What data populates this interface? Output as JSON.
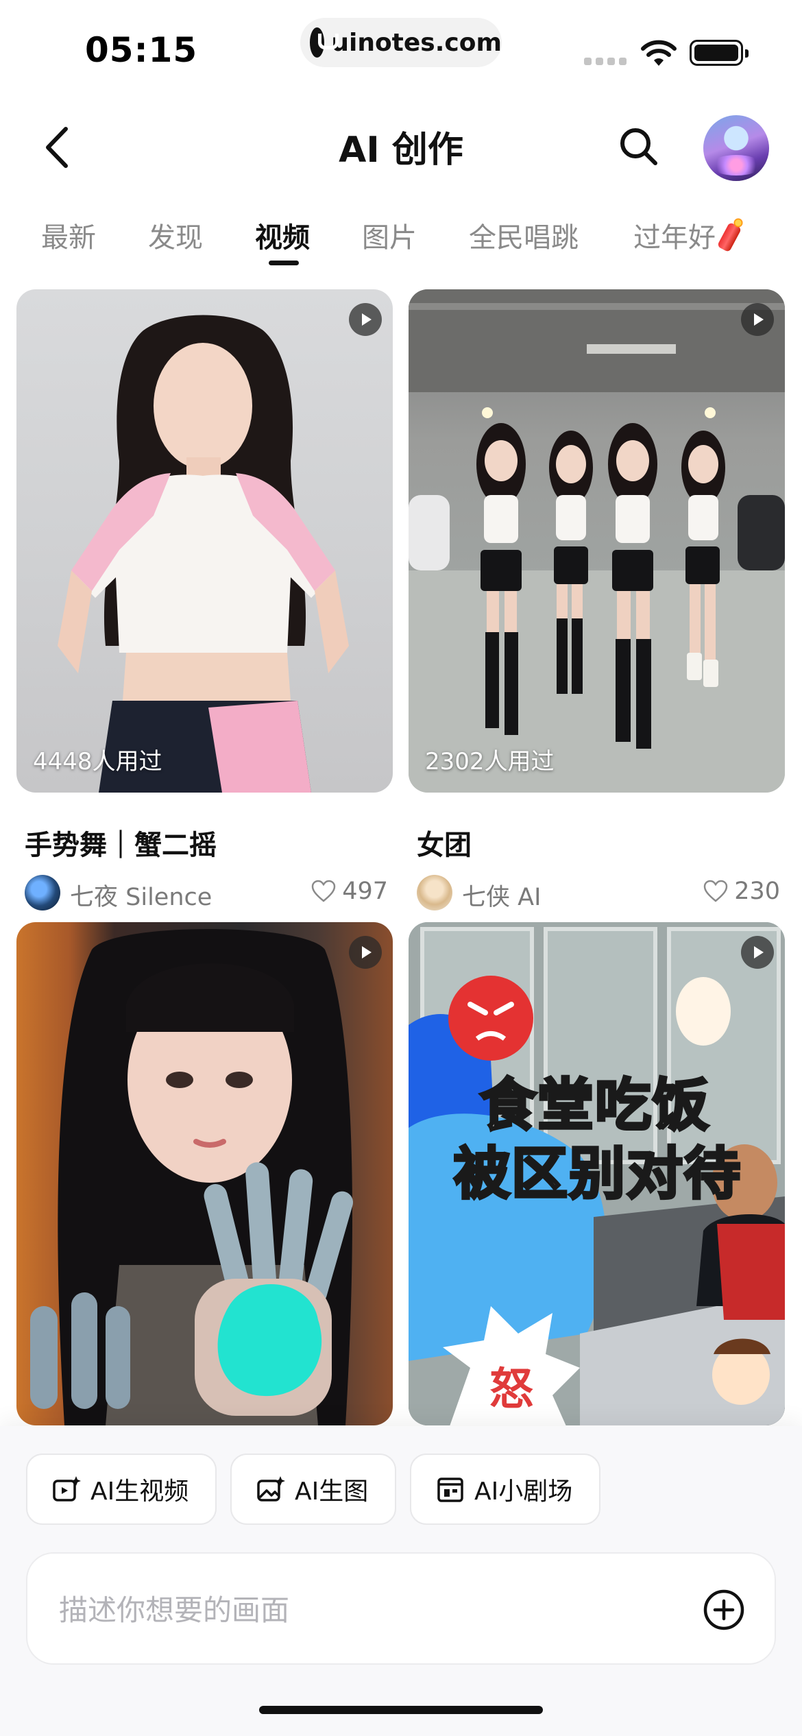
{
  "status_bar": {
    "time": "05:15",
    "url": "uinotes.com"
  },
  "nav": {
    "title": "AI 创作"
  },
  "tabs": [
    {
      "label": "最新"
    },
    {
      "label": "发现"
    },
    {
      "label": "视频",
      "active": true
    },
    {
      "label": "图片"
    },
    {
      "label": "全民唱跳"
    },
    {
      "label": "过年好"
    }
  ],
  "cards": [
    {
      "title": "手势舞｜蟹二摇",
      "used": "4448人用过",
      "author": "七夜 Silence",
      "likes": "497"
    },
    {
      "title": "女团",
      "used": "2302人用过",
      "author": "七侠 AI",
      "likes": "230"
    },
    {
      "title": "",
      "used": "",
      "author": "",
      "likes": ""
    },
    {
      "title": "",
      "used": "",
      "author": "",
      "likes": "",
      "overlay_line1": "食堂吃饭",
      "overlay_line2": "被区别对待",
      "overlay_burst": "怒"
    }
  ],
  "bottom": {
    "chips": [
      {
        "label": "AI生视频",
        "icon": "video-sparkle-icon"
      },
      {
        "label": "AI生图",
        "icon": "image-sparkle-icon"
      },
      {
        "label": "AI小剧场",
        "icon": "theater-icon"
      }
    ],
    "prompt_placeholder": "描述你想要的画面"
  },
  "colors": {
    "text_primary": "#111111",
    "text_secondary": "#7a7a7a",
    "tab_inactive": "#8a8a8a",
    "placeholder": "#b3b3b8"
  }
}
